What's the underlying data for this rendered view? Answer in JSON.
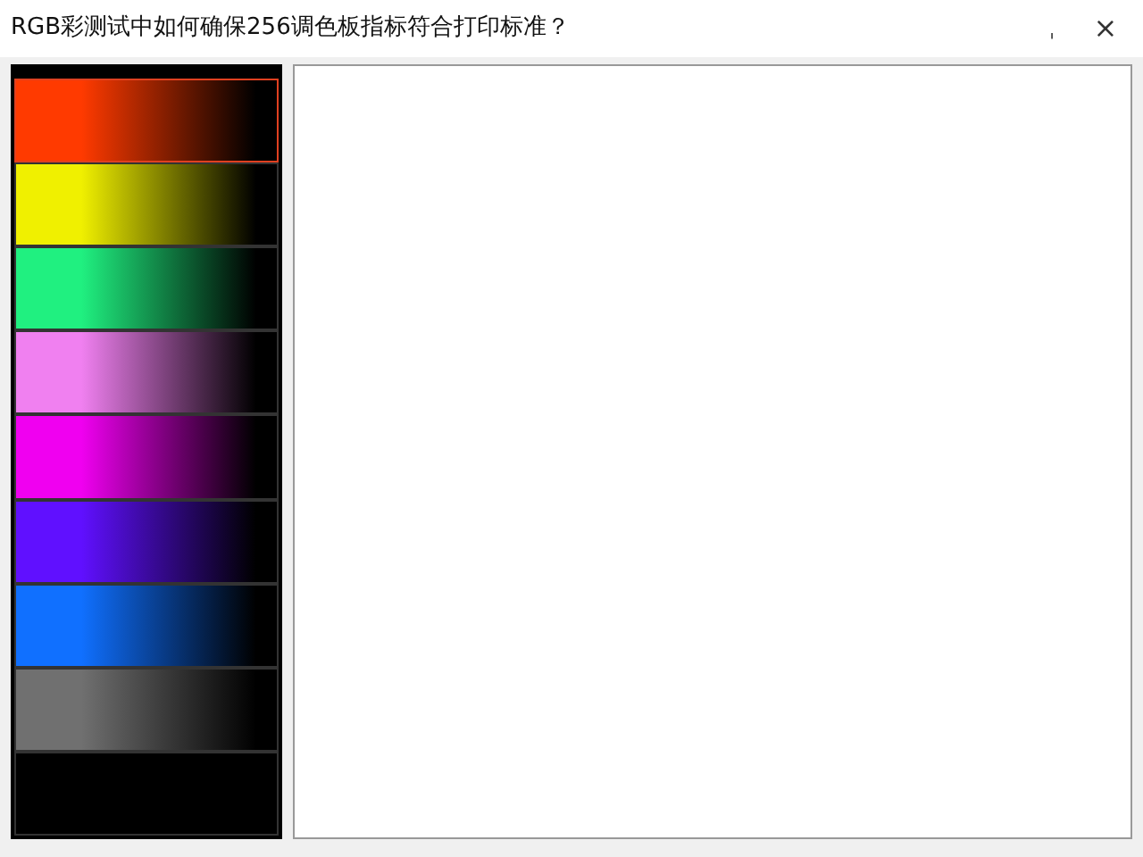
{
  "window": {
    "title": "RGB彩测试中如何确保256调色板指标符合打印标准？",
    "minimize": "ˌ",
    "close": "×"
  },
  "swatches": [
    {
      "color": "#ff3a00",
      "selected": true
    },
    {
      "color": "#f0f000",
      "selected": false
    },
    {
      "color": "#20f080",
      "selected": false
    },
    {
      "color": "#f080f0",
      "selected": false
    },
    {
      "color": "#f000f0",
      "selected": false
    },
    {
      "color": "#6010ff",
      "selected": false
    },
    {
      "color": "#1070ff",
      "selected": false
    },
    {
      "color": "#707070",
      "selected": false
    },
    {
      "color": "#000000",
      "selected": false
    }
  ]
}
